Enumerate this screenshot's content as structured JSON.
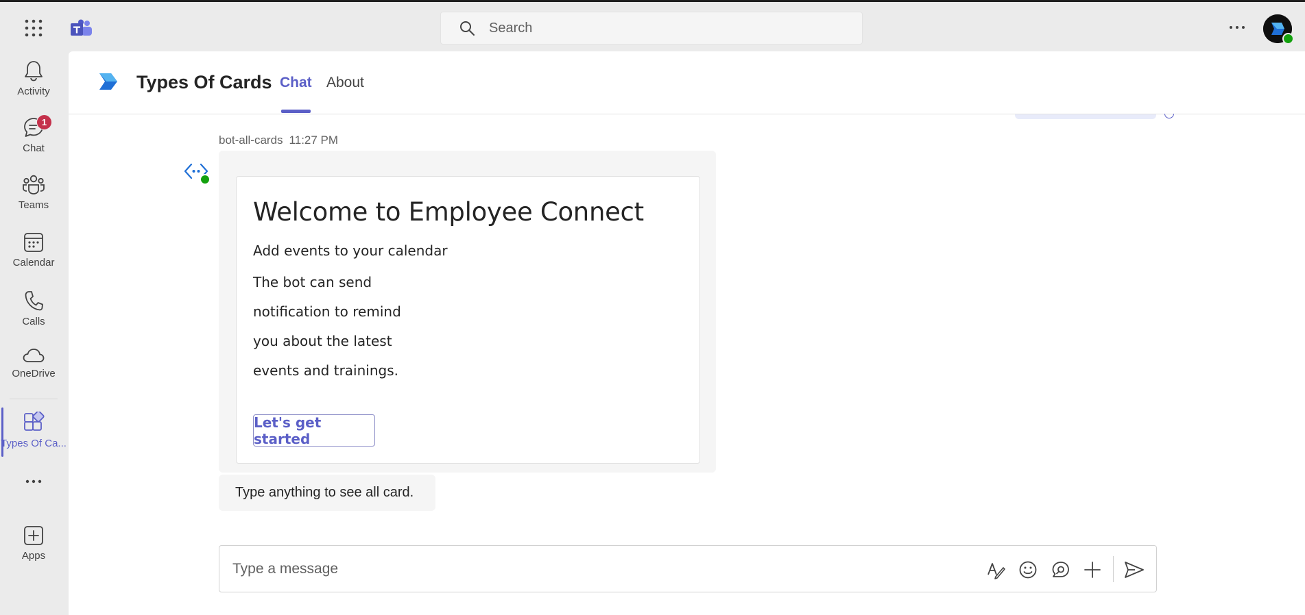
{
  "topbar": {
    "search_placeholder": "Search",
    "icons": [
      "apps-grid-icon",
      "teams-logo-icon",
      "search-icon",
      "more-options-icon",
      "user-avatar"
    ]
  },
  "rail": {
    "items": [
      {
        "label": "Activity",
        "icon": "bell-icon"
      },
      {
        "label": "Chat",
        "icon": "chat-icon",
        "badge": "1"
      },
      {
        "label": "Teams",
        "icon": "teams-icon"
      },
      {
        "label": "Calendar",
        "icon": "calendar-icon"
      },
      {
        "label": "Calls",
        "icon": "phone-icon"
      },
      {
        "label": "OneDrive",
        "icon": "cloud-icon"
      },
      {
        "label": "Types Of Ca...",
        "icon": "app-icon",
        "active": true
      }
    ],
    "more_label": "...",
    "apps_label": "Apps"
  },
  "header": {
    "app_title": "Types Of Cards",
    "tabs": [
      {
        "label": "Chat",
        "active": true
      },
      {
        "label": "About",
        "active": false
      }
    ]
  },
  "message": {
    "sender": "bot-all-cards",
    "time": "11:27 PM",
    "card": {
      "title": "Welcome to Employee Connect",
      "subtitle": "Add events to your calendar",
      "body_lines": [
        "The bot can send",
        "notification to remind",
        "you about the latest",
        "events and trainings."
      ],
      "button_label": "Let's get started"
    },
    "followup_text": "Type anything to see all card."
  },
  "compose": {
    "placeholder": "Type a message",
    "icons": [
      "format-icon",
      "emoji-icon",
      "loop-icon",
      "attach-plus-icon",
      "send-icon"
    ]
  },
  "colors": {
    "accent": "#5b5fc7",
    "badge": "#c4314b",
    "presence": "#13a10e",
    "rail_bg": "#ebebeb"
  }
}
